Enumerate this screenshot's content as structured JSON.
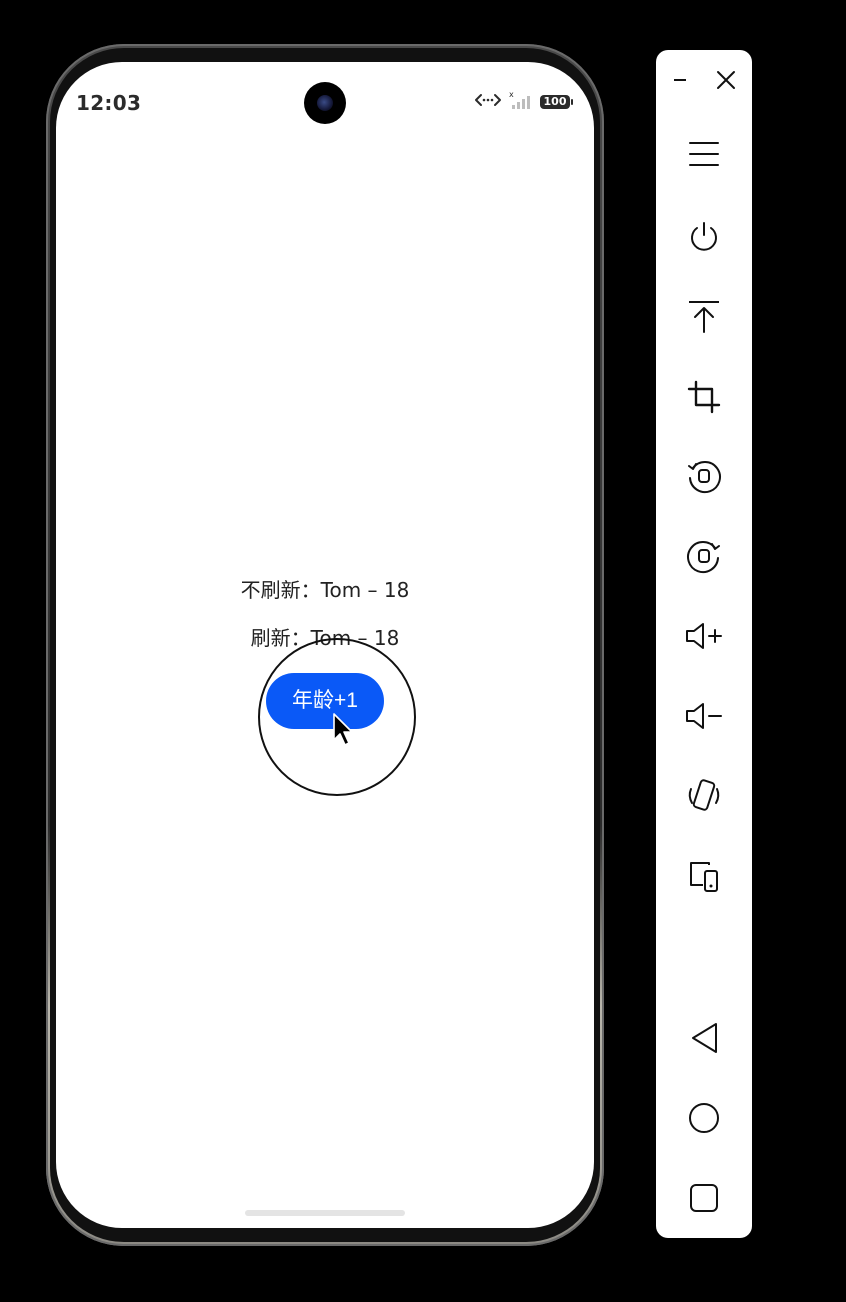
{
  "status_bar": {
    "time": "12:03",
    "battery": "100"
  },
  "content": {
    "line_no_refresh": "不刷新：Tom – 18",
    "line_refresh": "刷新：Tom – 18",
    "button_label": "年龄+1"
  },
  "colors": {
    "accent": "#0a59f7",
    "screen_background": "#ffffff",
    "text": "#222222"
  },
  "toolbar": {
    "icons": [
      "minimize-icon",
      "close-icon",
      "menu-icon",
      "power-icon",
      "pin-top-icon",
      "crop-icon",
      "rotate-left-icon",
      "rotate-right-icon",
      "volume-up-icon",
      "volume-down-icon",
      "shake-icon",
      "multi-device-icon",
      "back-icon",
      "home-icon",
      "recents-icon"
    ]
  }
}
